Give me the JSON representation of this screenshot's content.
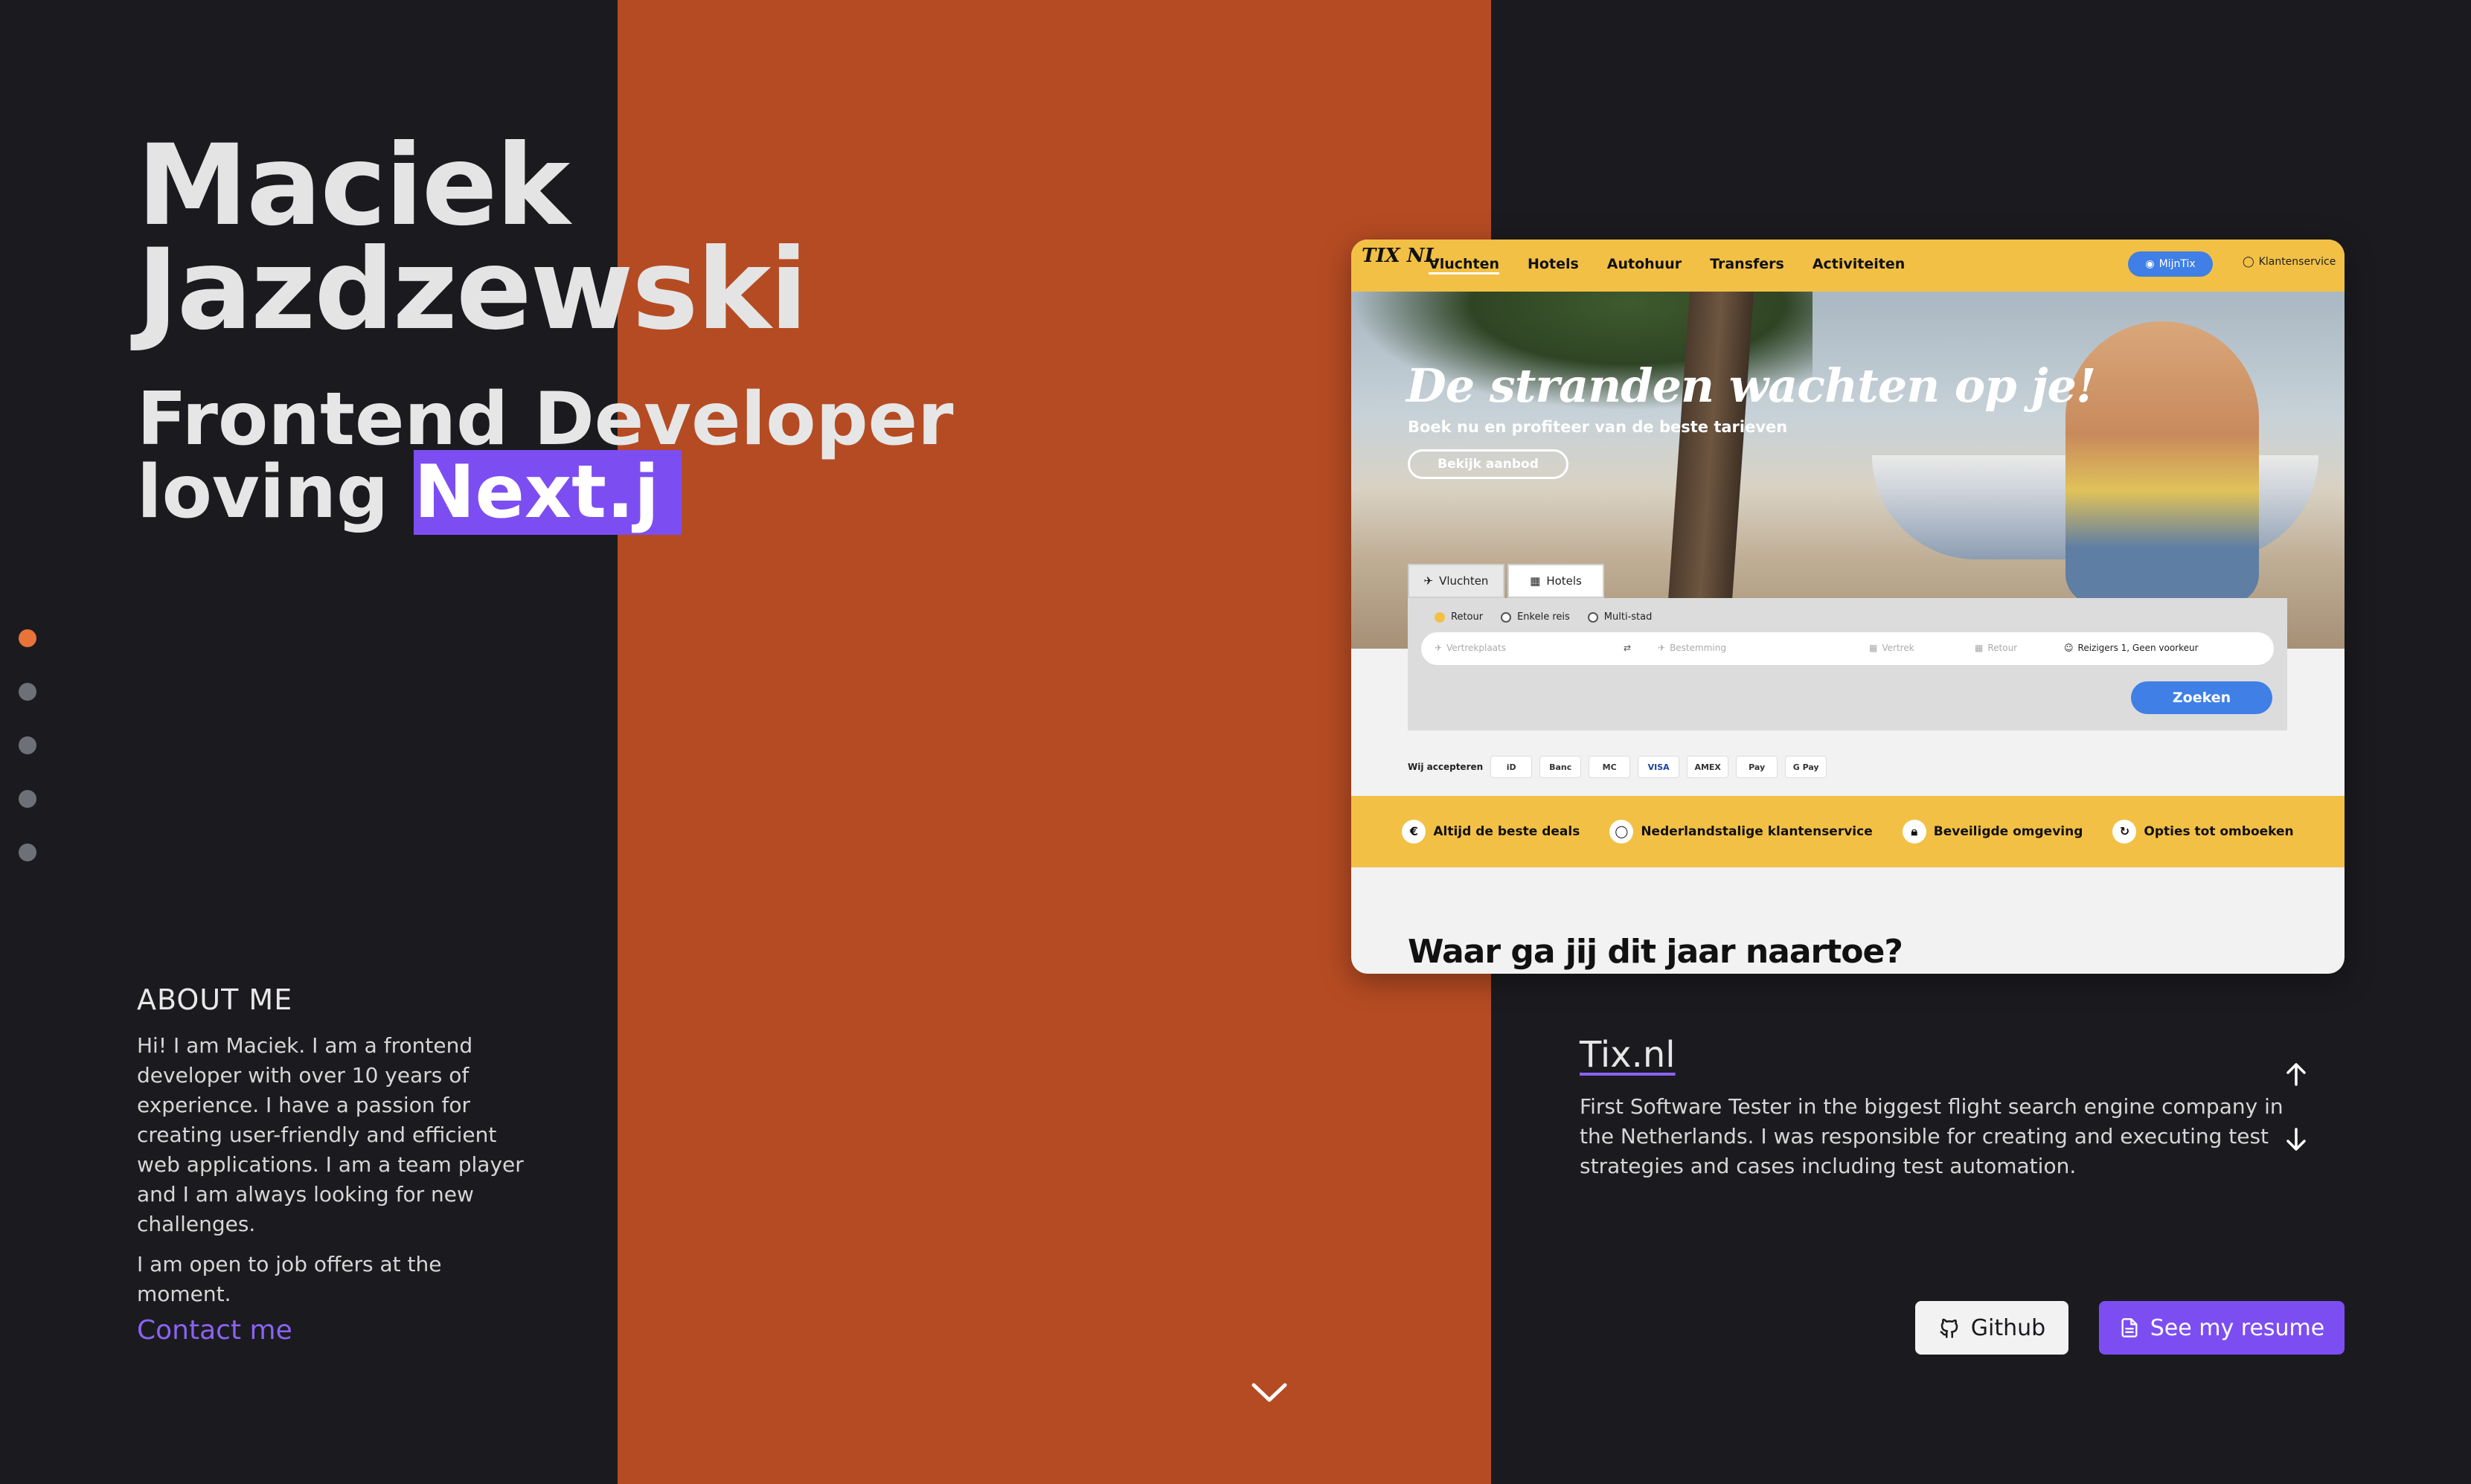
{
  "hero": {
    "name_first": "Maciek",
    "name_last": "Jazdzewski",
    "subtitle_line1": "Frontend Developer",
    "subtitle_prefix": "loving ",
    "subtitle_highlight": "Next.j"
  },
  "nav_dots": {
    "count": 5,
    "active_index": 0
  },
  "about": {
    "title": "ABOUT ME",
    "paragraph1": "Hi! I am Maciek. I am a frontend developer with over 10 years of experience. I have a passion for creating user-friendly and efficient web applications. I am a team player and I am always looking for new challenges.",
    "paragraph2": "I am open to job offers at the moment.",
    "contact_link": "Contact me"
  },
  "project_screenshot": {
    "logo": "TIX NL",
    "menu": [
      "Vluchten",
      "Hotels",
      "Autohuur",
      "Transfers",
      "Activiteiten"
    ],
    "account": "MijnTix",
    "service": "Klantenservice",
    "headline": "De stranden wachten op je!",
    "subhead": "Boek nu en profiteer van de beste tarieven",
    "cta": "Bekijk aanbod",
    "tabs": [
      "Vluchten",
      "Hotels"
    ],
    "trip_types": [
      "Retour",
      "Enkele reis",
      "Multi-stad"
    ],
    "fields": {
      "from": "Vertrekplaats",
      "to": "Bestemming",
      "depart": "Vertrek",
      "return": "Retour",
      "travellers": "Reizigers 1, Geen voorkeur"
    },
    "search_button": "Zoeken",
    "payments_label": "Wij accepteren",
    "payment_methods": [
      "iD",
      "Banc",
      "MC",
      "VISA",
      "AMEX",
      "Pay",
      "G Pay"
    ],
    "usps": [
      "Altijd de beste deals",
      "Nederlandstalige klantenservice",
      "Beveiligde omgeving",
      "Opties tot omboeken"
    ],
    "section_title": "Waar ga jij dit jaar naartoe?"
  },
  "project": {
    "title": "Tix.nl",
    "description": "First Software Tester in the biggest flight search engine company in the Netherlands. I was responsible for creating and executing test strategies and cases including test automation."
  },
  "buttons": {
    "github": "Github",
    "resume": "See my resume"
  },
  "colors": {
    "background": "#1b1b1f",
    "orange": "#b54b23",
    "accent": "#7c4ef2",
    "tix_yellow": "#f2c045"
  }
}
